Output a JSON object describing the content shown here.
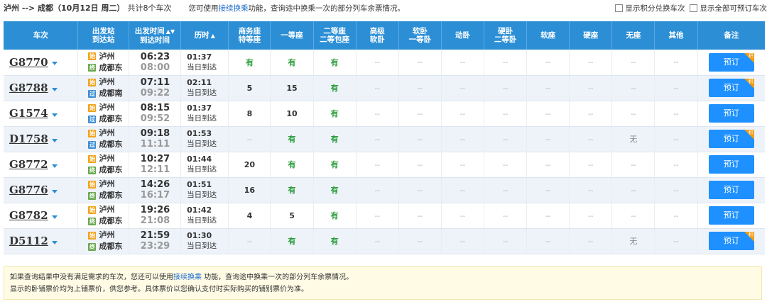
{
  "header": {
    "route": "泸州 --> 成都（10月12日 周二）",
    "total": "共计8个车次",
    "tip_prefix": "您可使用",
    "tip_link": "接续换乘",
    "tip_suffix": "功能，查询途中换乘一次的部分列车余票情况。",
    "filter_points": "显示积分兑换车次",
    "filter_all": "显示全部可预订车次"
  },
  "columns": [
    {
      "line1": "车次",
      "line2": ""
    },
    {
      "line1": "出发站",
      "line2": "到达站"
    },
    {
      "line1": "出发时间",
      "line2": "到达时间"
    },
    {
      "line1": "历时",
      "line2": ""
    },
    {
      "line1": "商务座",
      "line2": "特等座"
    },
    {
      "line1": "一等座",
      "line2": ""
    },
    {
      "line1": "二等座",
      "line2": "二等包座"
    },
    {
      "line1": "高级",
      "line2": "软卧"
    },
    {
      "line1": "软卧",
      "line2": "一等卧"
    },
    {
      "line1": "动卧",
      "line2": ""
    },
    {
      "line1": "硬卧",
      "line2": "二等卧"
    },
    {
      "line1": "软座",
      "line2": ""
    },
    {
      "line1": "硬座",
      "line2": ""
    },
    {
      "line1": "无座",
      "line2": ""
    },
    {
      "line1": "其他",
      "line2": ""
    },
    {
      "line1": "备注",
      "line2": ""
    }
  ],
  "badges": {
    "start": "始",
    "end": "终",
    "pass": "过"
  },
  "book_label": "预订",
  "tag_label": "积",
  "rows": [
    {
      "train": "G8770",
      "from": "泸州",
      "to": "成都东",
      "to_type": "end",
      "dep": "06:23",
      "arr": "08:00",
      "dur": "01:37",
      "dur_note": "当日到达",
      "seats": [
        "有",
        "有",
        "有",
        "--",
        "--",
        "--",
        "--",
        "--",
        "--",
        "--",
        "--"
      ],
      "tag": true
    },
    {
      "train": "G8788",
      "from": "泸州",
      "to": "成都南",
      "to_type": "pass",
      "dep": "07:11",
      "arr": "09:22",
      "dur": "02:11",
      "dur_note": "当日到达",
      "seats": [
        "5",
        "15",
        "有",
        "--",
        "--",
        "--",
        "--",
        "--",
        "--",
        "--",
        "--"
      ],
      "tag": true
    },
    {
      "train": "G1574",
      "from": "泸州",
      "to": "成都东",
      "to_type": "pass",
      "dep": "08:15",
      "arr": "09:52",
      "dur": "01:37",
      "dur_note": "当日到达",
      "seats": [
        "8",
        "10",
        "有",
        "--",
        "--",
        "--",
        "--",
        "--",
        "--",
        "--",
        "--"
      ],
      "tag": false
    },
    {
      "train": "D1758",
      "from": "泸州",
      "to": "成都东",
      "to_type": "pass",
      "dep": "09:18",
      "arr": "11:11",
      "dur": "01:53",
      "dur_note": "当日到达",
      "seats": [
        "--",
        "有",
        "有",
        "--",
        "--",
        "--",
        "--",
        "--",
        "--",
        "无",
        "--"
      ],
      "tag": true
    },
    {
      "train": "G8772",
      "from": "泸州",
      "to": "成都东",
      "to_type": "end",
      "dep": "10:27",
      "arr": "12:11",
      "dur": "01:44",
      "dur_note": "当日到达",
      "seats": [
        "20",
        "有",
        "有",
        "--",
        "--",
        "--",
        "--",
        "--",
        "--",
        "--",
        "--"
      ],
      "tag": false
    },
    {
      "train": "G8776",
      "from": "泸州",
      "to": "成都东",
      "to_type": "end",
      "dep": "14:26",
      "arr": "16:17",
      "dur": "01:51",
      "dur_note": "当日到达",
      "seats": [
        "16",
        "有",
        "有",
        "--",
        "--",
        "--",
        "--",
        "--",
        "--",
        "--",
        "--"
      ],
      "tag": false
    },
    {
      "train": "G8782",
      "from": "泸州",
      "to": "成都东",
      "to_type": "end",
      "dep": "19:26",
      "arr": "21:08",
      "dur": "01:42",
      "dur_note": "当日到达",
      "seats": [
        "4",
        "5",
        "有",
        "--",
        "--",
        "--",
        "--",
        "--",
        "--",
        "--",
        "--"
      ],
      "tag": false
    },
    {
      "train": "D5112",
      "from": "泸州",
      "to": "成都东",
      "to_type": "end",
      "dep": "21:59",
      "arr": "23:29",
      "dur": "01:30",
      "dur_note": "当日到达",
      "seats": [
        "--",
        "有",
        "有",
        "--",
        "--",
        "--",
        "--",
        "--",
        "--",
        "无",
        "--"
      ],
      "tag": true
    }
  ],
  "notice": {
    "line1_prefix": "如果查询结果中没有满足需求的车次，您还可以使用",
    "line1_link": "接续换乘",
    "line1_suffix": " 功能，查询途中换乘一次的部分列车余票情况。",
    "line2": "显示的卧铺票价均为上铺票价，供您参考。具体票价以您确认支付时实际购买的铺别票价为准。"
  },
  "colors": {
    "header_bg": "#2c8fd6",
    "book_bg": "#1e90ff",
    "available": "#2a9d3a",
    "tag": "#f39c12",
    "notice_bg": "#fffbe5"
  }
}
